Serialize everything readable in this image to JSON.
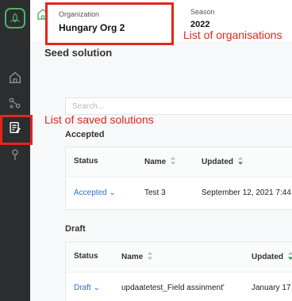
{
  "colors": {
    "accent_red": "#e3261c",
    "link_blue": "#2f6fcf",
    "brand_green": "#4bb56a",
    "sidebar": "#2b2d2f"
  },
  "sidebar": {
    "items": [
      {
        "icon": "home-icon"
      },
      {
        "icon": "share-nodes-icon"
      },
      {
        "icon": "saved-solutions-icon",
        "active": true
      },
      {
        "icon": "location-pin-icon"
      }
    ]
  },
  "header": {
    "organization": {
      "label": "Organization",
      "value": "Hungary Org 2"
    },
    "season": {
      "label": "Season",
      "value": "2022"
    }
  },
  "annotations": {
    "organisations": "List of organisations",
    "saved_solutions": "List of saved solutions"
  },
  "page": {
    "title": "Seed solution",
    "search_placeholder": "Search..."
  },
  "accepted": {
    "title": "Accepted",
    "columns": [
      "Status",
      "Name",
      "Updated"
    ],
    "rows": [
      {
        "status": "Accepted",
        "name": "Test 3",
        "updated": "September 12, 2021 7:44"
      }
    ]
  },
  "draft": {
    "title": "Draft",
    "columns": [
      "Status",
      "Name",
      "Updated"
    ],
    "rows": [
      {
        "status": "Draft",
        "name": "updaatetest_Field assinment'",
        "updated": "January 17"
      }
    ]
  }
}
